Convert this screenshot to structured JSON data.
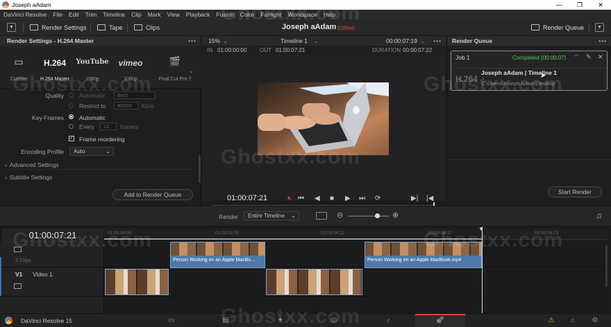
{
  "window": {
    "title": "Joseph aAdam",
    "min": "—",
    "max": "❐",
    "close": "✕"
  },
  "menu": [
    "DaVinci Resolve",
    "File",
    "Edit",
    "Trim",
    "Timeline",
    "Clip",
    "Mark",
    "View",
    "Playback",
    "Fusion",
    "Color",
    "Fairlight",
    "Workspace",
    "Help"
  ],
  "toolbar": {
    "render_settings": "Render Settings",
    "tape": "Tape",
    "clips": "Clips",
    "project": "Joseph aAdam",
    "project_status": "Edited",
    "render_queue": "Render Queue"
  },
  "render_settings": {
    "title": "Render Settings - H.264 Master",
    "presets": [
      {
        "logo": "▭",
        "label": "Custom"
      },
      {
        "logo": "H.264",
        "label": "H.264 Master"
      },
      {
        "logo": "YouTube",
        "label": "1080p"
      },
      {
        "logo": "vimeo",
        "label": "1080p"
      },
      {
        "logo": "🎬",
        "label": "Final Cut Pro 7"
      }
    ],
    "quality_label": "Quality",
    "quality_auto": "Automatic",
    "quality_best": "Best",
    "restrict_to": "Restrict to",
    "restrict_value": "80000",
    "restrict_unit": "Kb/s",
    "key_frames_label": "Key Frames",
    "key_auto": "Automatic",
    "key_every": "Every",
    "key_every_value": "12",
    "key_every_unit": "frames",
    "frame_reordering": "Frame reordering",
    "encoding_profile_label": "Encoding Profile",
    "encoding_profile_value": "Auto",
    "advanced_settings": "Advanced Settings",
    "subtitle_settings": "Subtitle Settings",
    "add_to_queue": "Add to Render Queue"
  },
  "viewer": {
    "zoom": "15%",
    "timeline_name": "Timeline 1",
    "timecode_top": "00:00:07:19",
    "in_label": "IN",
    "in_value": "01:00:00:00",
    "out_label": "OUT",
    "out_value": "01:00:07:21",
    "duration_label": "DURATION",
    "duration_value": "00:00:07:22",
    "current_tc": "01:00:07:21"
  },
  "render_queue": {
    "title": "Render Queue",
    "job_name": "Job 1",
    "job_status": "Completed (00:00:07)",
    "job_timeline": "Joseph aAdam | Timeline 1",
    "job_codec": "H.264",
    "job_path": "C:\\Users\\Joseph Adam\\Desktop",
    "start_render": "Start Render"
  },
  "render_bar": {
    "label": "Render",
    "value": "Entire Timeline"
  },
  "timeline": {
    "timecode": "01:00:07:21",
    "ruler": [
      "01:00:00:00",
      "01:00:02:05",
      "01:00:04:11",
      "01:00:06:17",
      "01:00:08:23"
    ],
    "track_a_clips": "2 Clips",
    "v1_label": "V1",
    "v1_name": "Video 1",
    "clip1_name": "Person Working on an Apple MacBo...",
    "clip2_name": "Person Working on an Apple MacBook.mp4"
  },
  "bottombar": {
    "app": "DaVinci Resolve 15"
  },
  "watermark": "Ghostxx.com"
}
